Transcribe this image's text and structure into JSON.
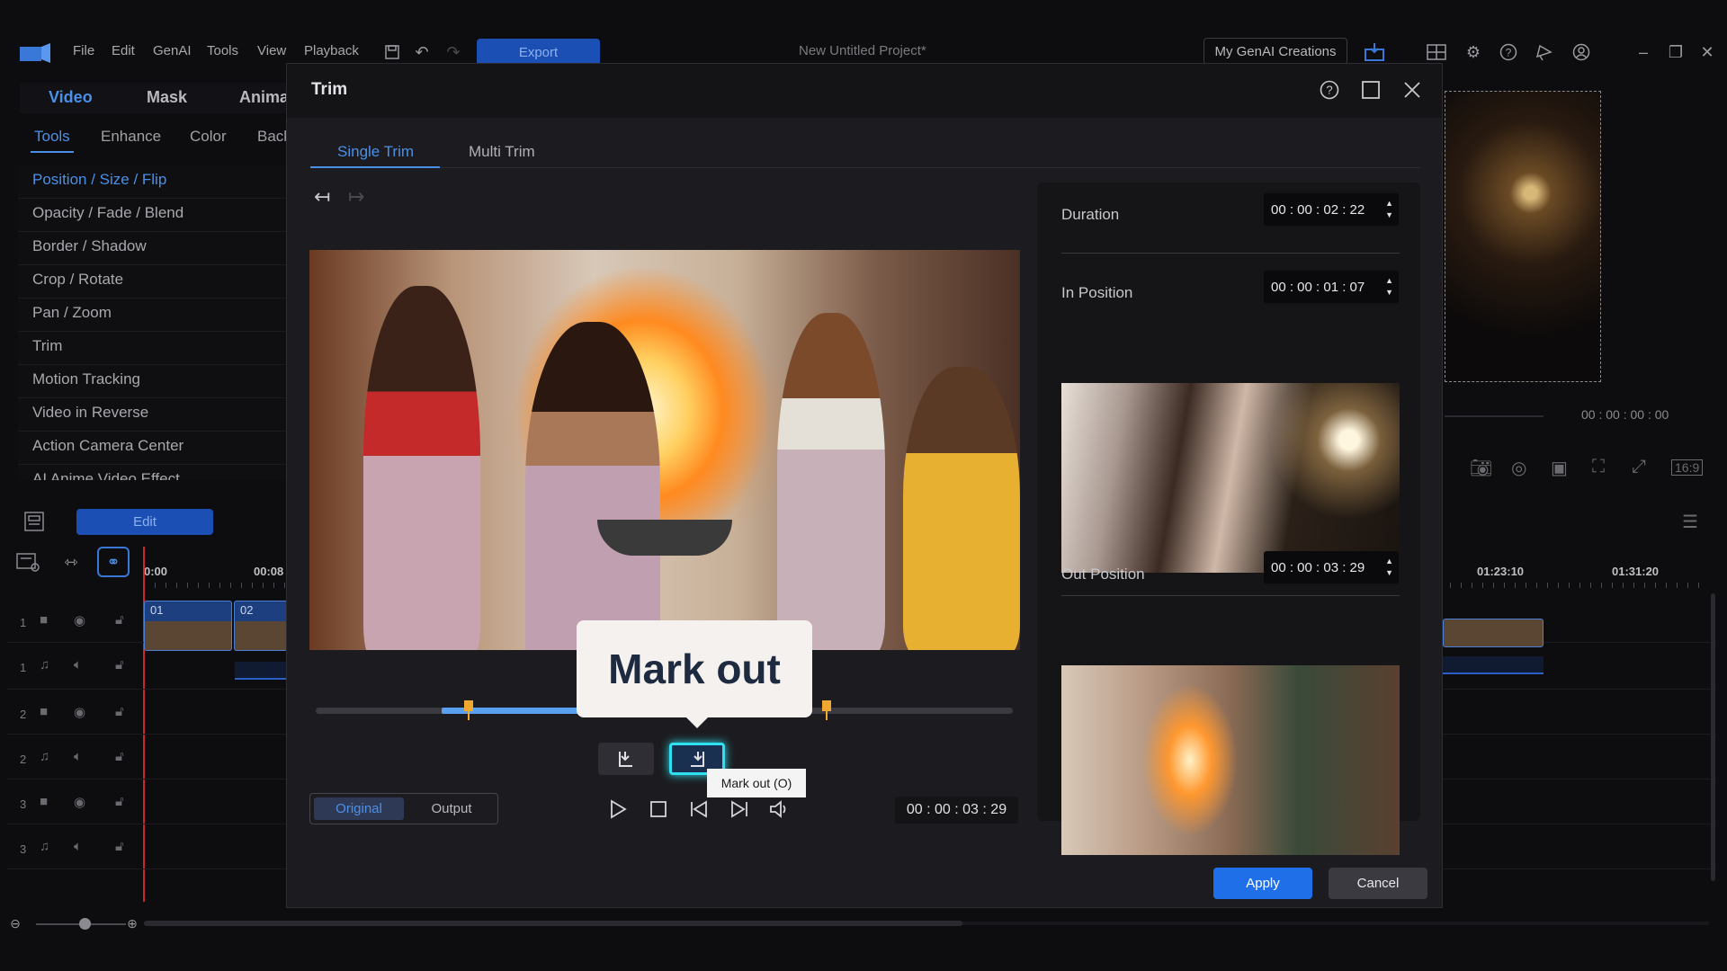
{
  "menubar": {
    "items": [
      "File",
      "Edit",
      "GenAI",
      "Tools",
      "View",
      "Playback"
    ],
    "export_label": "Export",
    "project_title": "New Untitled Project*",
    "genai_creations": "My GenAI Creations"
  },
  "left_panel": {
    "main_tabs": [
      "Video",
      "Mask",
      "Anima"
    ],
    "sub_tabs": [
      "Tools",
      "Enhance",
      "Color",
      "Back"
    ],
    "tools": [
      "Position / Size / Flip",
      "Opacity / Fade / Blend",
      "Border / Shadow",
      "Crop / Rotate",
      "Pan / Zoom",
      "Trim",
      "Motion Tracking",
      "Video in Reverse",
      "Action Camera Center",
      "AI Anime Video Effect"
    ],
    "edit_label": "Edit"
  },
  "timeline": {
    "ruler": [
      "0:00",
      "00:08",
      "01:23:10",
      "01:31:20"
    ],
    "tracks": [
      "1",
      "1",
      "2",
      "2",
      "3",
      "3"
    ],
    "clips": [
      "01",
      "02"
    ]
  },
  "preview": {
    "timecode": "00 : 00 : 00 : 00"
  },
  "trim_dialog": {
    "title": "Trim",
    "tabs": [
      "Single Trim",
      "Multi Trim"
    ],
    "callout": "Mark out",
    "tooltip": "Mark out (O)",
    "mode_original": "Original",
    "mode_output": "Output",
    "current_time": "00 : 00 : 03 : 29",
    "duration_label": "Duration",
    "duration_value": "00 : 00 : 02 : 22",
    "in_label": "In Position",
    "in_value": "00 : 00 : 01 : 07",
    "out_label": "Out Position",
    "out_value": "00 : 00 : 03 : 29",
    "apply_label": "Apply",
    "cancel_label": "Cancel"
  }
}
